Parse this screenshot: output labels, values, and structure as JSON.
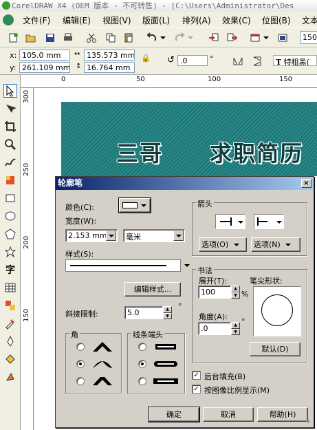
{
  "titlebar": {
    "text": "CorelDRAW X4 (OEM 版本 - 不可转售) - [C:\\Users\\Administrator\\Des"
  },
  "menu": [
    "文件(F)",
    "编辑(E)",
    "视图(V)",
    "版面(L)",
    "排列(A)",
    "效果(C)",
    "位图(B)",
    "文本"
  ],
  "toolbar": {
    "zoom": "150°"
  },
  "propbar": {
    "x_label": "x:",
    "x": "105.0 mm",
    "y_label": "y:",
    "y": "261.109 mm",
    "w": "135.573 mm",
    "h": "16.764 mm",
    "angle": ".0",
    "angle_unit": "°",
    "font": "特粗黑("
  },
  "rulers": {
    "h": [
      "0",
      "50",
      "100",
      "150"
    ],
    "v": [
      "300",
      "250",
      "200",
      "150"
    ]
  },
  "canvas": {
    "banner_text_1": "三哥",
    "banner_text_2": "求职简历"
  },
  "dialog": {
    "title": "轮廓笔",
    "close": "×",
    "color_label": "颜色(C):",
    "width_label": "宽度(W):",
    "width_value": "2.153 mm",
    "unit_value": "毫米",
    "style_label": "样式(S):",
    "edit_style": "编辑样式...",
    "miter_label": "斜接限制:",
    "miter_value": "5.0",
    "miter_unit": "°",
    "corner_label": "角",
    "linecap_label": "线条端头",
    "arrow_label": "箭头",
    "options1": "选项(O)",
    "options2": "选项(N)",
    "calligraphy_label": "书法",
    "stretch_label": "展开(T):",
    "stretch_value": "100",
    "stretch_unit": "%",
    "nib_label": "笔尖形状:",
    "angle_label": "角度(A):",
    "angle_value": ".0",
    "angle_unit": "°",
    "default_btn": "默认(D)",
    "behind_fill": "后台填充(B)",
    "scale_with_image": "按图像比例显示(M)",
    "ok": "确定",
    "cancel": "取消",
    "help": "帮助(H)"
  },
  "checkmark": "✓",
  "colors": {
    "banner": "#2a8b8b",
    "dialog_title": "#0a246a"
  }
}
